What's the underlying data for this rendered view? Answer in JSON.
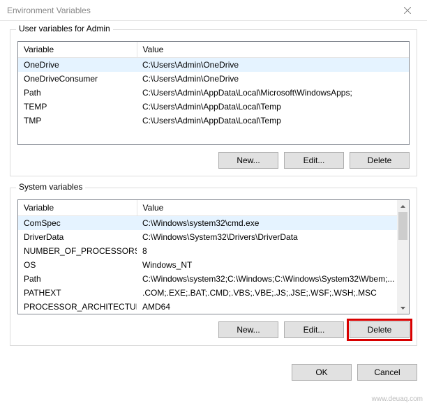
{
  "window": {
    "title": "Environment Variables"
  },
  "user_group": {
    "legend": "User variables for Admin",
    "columns": {
      "var": "Variable",
      "val": "Value"
    },
    "rows": [
      {
        "var": "OneDrive",
        "val": "C:\\Users\\Admin\\OneDrive",
        "selected": true
      },
      {
        "var": "OneDriveConsumer",
        "val": "C:\\Users\\Admin\\OneDrive",
        "selected": false
      },
      {
        "var": "Path",
        "val": "C:\\Users\\Admin\\AppData\\Local\\Microsoft\\WindowsApps;",
        "selected": false
      },
      {
        "var": "TEMP",
        "val": "C:\\Users\\Admin\\AppData\\Local\\Temp",
        "selected": false
      },
      {
        "var": "TMP",
        "val": "C:\\Users\\Admin\\AppData\\Local\\Temp",
        "selected": false
      }
    ],
    "buttons": {
      "new": "New...",
      "edit": "Edit...",
      "delete": "Delete"
    }
  },
  "system_group": {
    "legend": "System variables",
    "columns": {
      "var": "Variable",
      "val": "Value"
    },
    "rows": [
      {
        "var": "ComSpec",
        "val": "C:\\Windows\\system32\\cmd.exe",
        "selected": true
      },
      {
        "var": "DriverData",
        "val": "C:\\Windows\\System32\\Drivers\\DriverData",
        "selected": false
      },
      {
        "var": "NUMBER_OF_PROCESSORS",
        "val": "8",
        "selected": false
      },
      {
        "var": "OS",
        "val": "Windows_NT",
        "selected": false
      },
      {
        "var": "Path",
        "val": "C:\\Windows\\system32;C:\\Windows;C:\\Windows\\System32\\Wbem;...",
        "selected": false
      },
      {
        "var": "PATHEXT",
        "val": ".COM;.EXE;.BAT;.CMD;.VBS;.VBE;.JS;.JSE;.WSF;.WSH;.MSC",
        "selected": false
      },
      {
        "var": "PROCESSOR_ARCHITECTURE",
        "val": "AMD64",
        "selected": false
      }
    ],
    "buttons": {
      "new": "New...",
      "edit": "Edit...",
      "delete": "Delete"
    }
  },
  "dialog_buttons": {
    "ok": "OK",
    "cancel": "Cancel"
  },
  "watermark": "www.deuaq.com"
}
